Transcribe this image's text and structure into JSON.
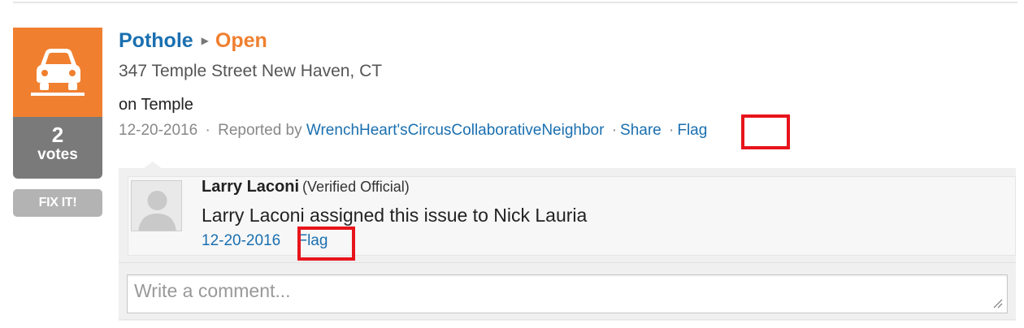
{
  "issue": {
    "type": "Pothole",
    "status": "Open",
    "address": "347 Temple Street New Haven, CT",
    "description": "on Temple",
    "date": "12-20-2016",
    "reported_by_prefix": "Reported by",
    "reporter": "WrenchHeart'sCircusCollaborativeNeighbor",
    "separator": "·",
    "share_label": "Share",
    "flag_label": "Flag",
    "icon": "car-pothole-icon"
  },
  "votes": {
    "count": "2",
    "label": "votes"
  },
  "fix_button": {
    "label": "FIX IT!"
  },
  "comment": {
    "author": "Larry Laconi",
    "role": "(Verified Official)",
    "text": "Larry Laconi assigned this issue to Nick Lauria",
    "date": "12-20-2016",
    "flag_label": "Flag",
    "avatar_icon": "default-avatar-icon"
  },
  "comment_box": {
    "placeholder": "Write a comment..."
  },
  "colors": {
    "accent_orange": "#f07f2f",
    "link_blue": "#1a6fb0",
    "highlight_red": "#e8141c",
    "votes_gray": "#7a7a7a"
  }
}
